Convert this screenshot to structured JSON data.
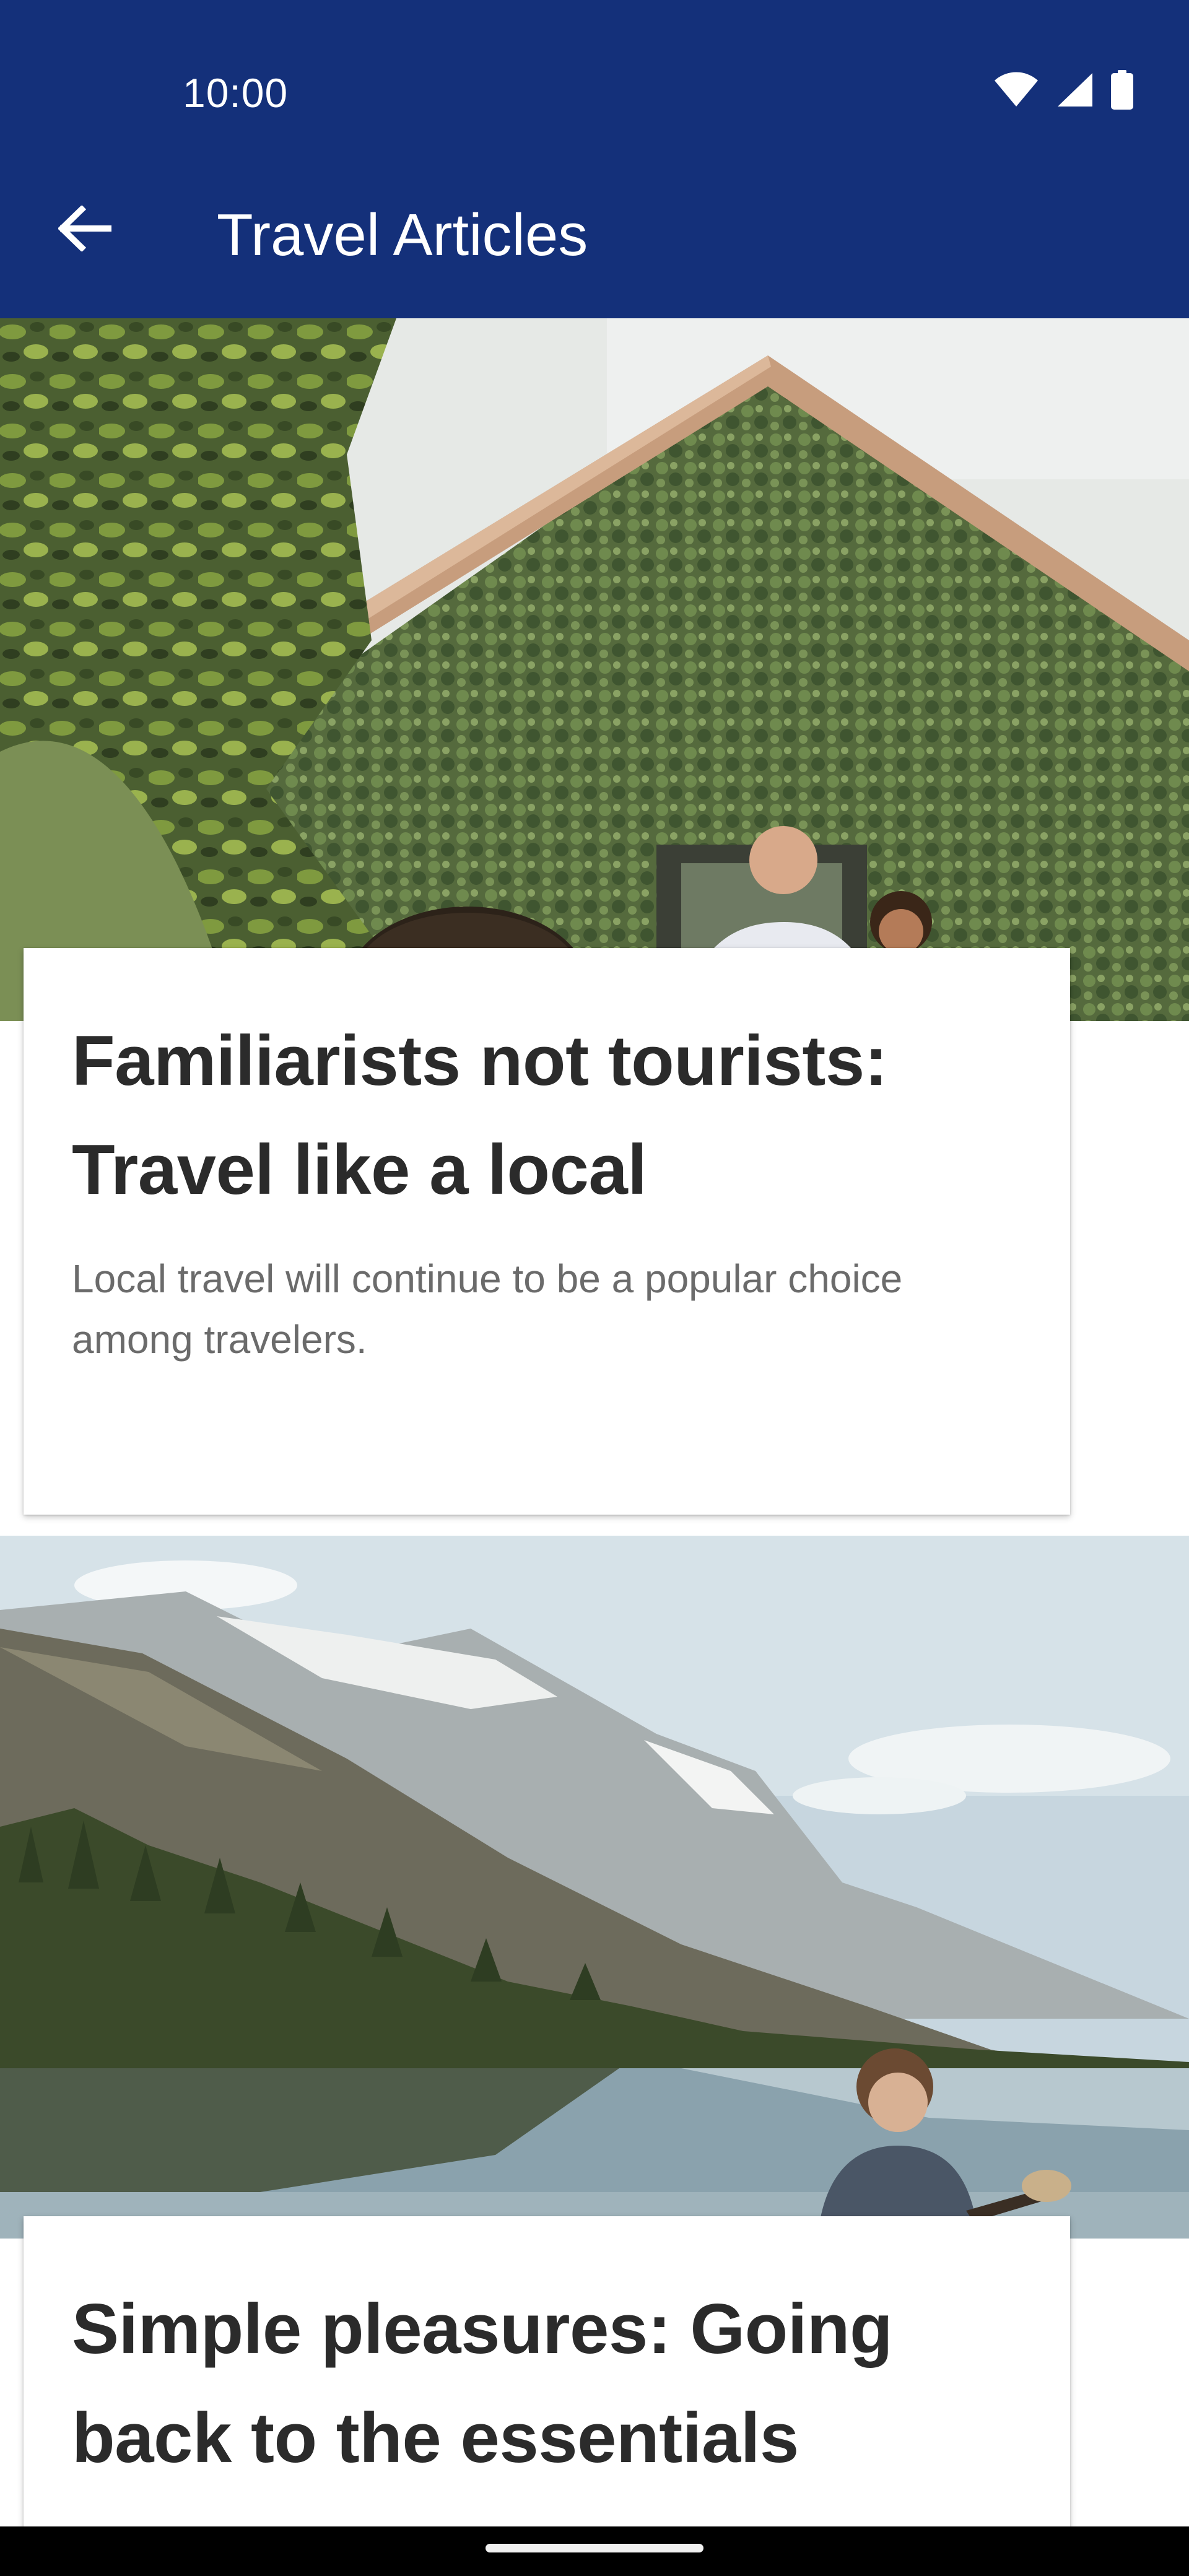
{
  "status_bar": {
    "time": "10:00",
    "icons": [
      "wifi-icon",
      "cellular-signal-icon",
      "battery-icon"
    ]
  },
  "app_bar": {
    "back_icon": "arrow-back-icon",
    "title": "Travel Articles"
  },
  "articles": [
    {
      "image": "ivy-covered-house-with-family-photo",
      "title": "Familiarists not tourists: Travel like a local",
      "description": "Local travel will continue to be a popular choice among travelers."
    },
    {
      "image": "mountain-lake-with-child-in-canoe-photo",
      "title": "Simple pleasures: Going back to the essentials",
      "description": ""
    }
  ],
  "colors": {
    "app_bar": "#14307a",
    "title_text": "#2b2b2b",
    "description_text": "#6b6b6b",
    "navigation_bar": "#000000"
  }
}
